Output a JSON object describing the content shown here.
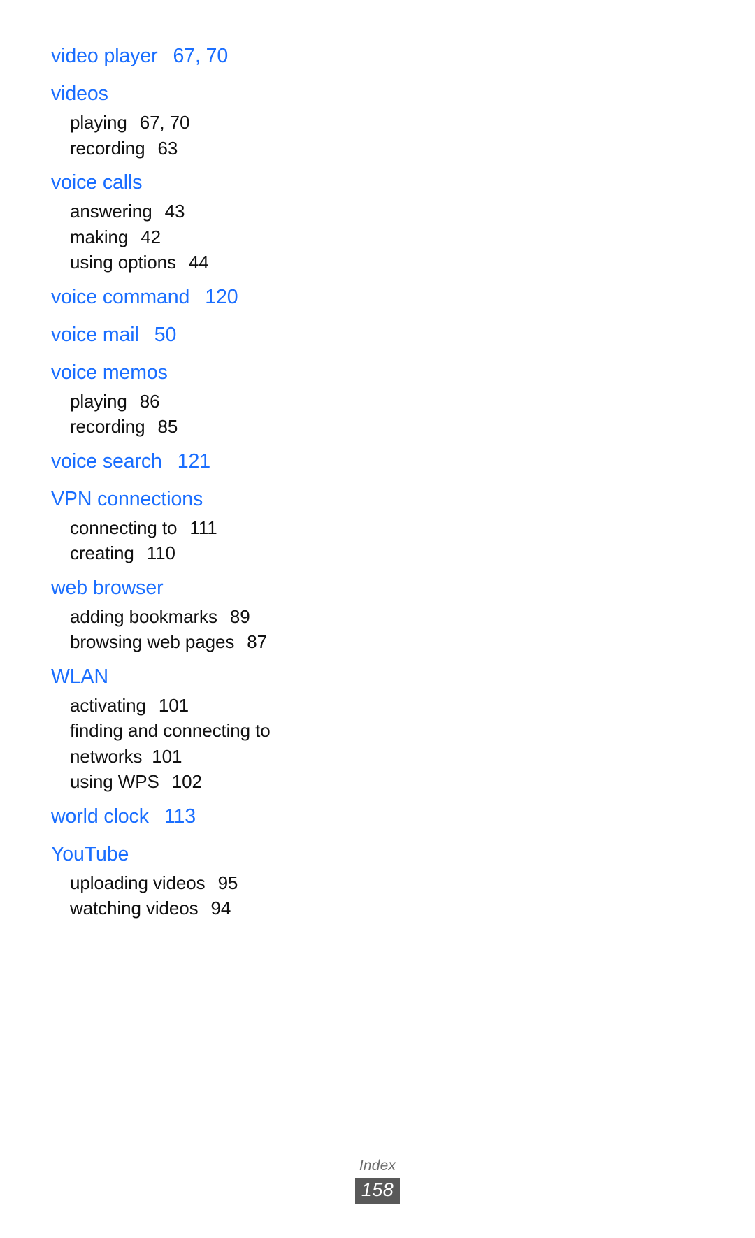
{
  "document": {
    "type": "index-page",
    "colors": {
      "heading": "#1a6eff",
      "body": "#111111",
      "footer_label": "#6b6b6b",
      "footer_box": "#595959",
      "page_background": "#ffffff"
    }
  },
  "index": {
    "entries": [
      {
        "term": "video player",
        "page": "67, 70",
        "sub": []
      },
      {
        "term": "videos",
        "page": "",
        "sub": [
          {
            "label": "playing",
            "page": "67, 70"
          },
          {
            "label": "recording",
            "page": "63"
          }
        ]
      },
      {
        "term": "voice calls",
        "page": "",
        "sub": [
          {
            "label": "answering",
            "page": "43"
          },
          {
            "label": "making",
            "page": "42"
          },
          {
            "label": "using options",
            "page": "44"
          }
        ]
      },
      {
        "term": "voice command",
        "page": "120",
        "sub": []
      },
      {
        "term": "voice mail",
        "page": "50",
        "sub": []
      },
      {
        "term": "voice memos",
        "page": "",
        "sub": [
          {
            "label": "playing",
            "page": "86"
          },
          {
            "label": "recording",
            "page": "85"
          }
        ]
      },
      {
        "term": "voice search",
        "page": "121",
        "sub": []
      },
      {
        "term": "VPN connections",
        "page": "",
        "sub": [
          {
            "label": "connecting to",
            "page": "111"
          },
          {
            "label": "creating",
            "page": "110"
          }
        ]
      },
      {
        "term": "web browser",
        "page": "",
        "sub": [
          {
            "label": "adding bookmarks",
            "page": "89"
          },
          {
            "label": "browsing web pages",
            "page": "87"
          }
        ]
      },
      {
        "term": "WLAN",
        "page": "",
        "sub": [
          {
            "label": "activating",
            "page": "101"
          },
          {
            "label": "finding and connecting to networks",
            "page": "101"
          },
          {
            "label": "using WPS",
            "page": "102"
          }
        ]
      },
      {
        "term": "world clock",
        "page": "113",
        "sub": []
      },
      {
        "term": "YouTube",
        "page": "",
        "sub": [
          {
            "label": "uploading videos",
            "page": "95"
          },
          {
            "label": "watching videos",
            "page": "94"
          }
        ]
      }
    ]
  },
  "footer": {
    "section_label": "Index",
    "page_number": "158"
  }
}
